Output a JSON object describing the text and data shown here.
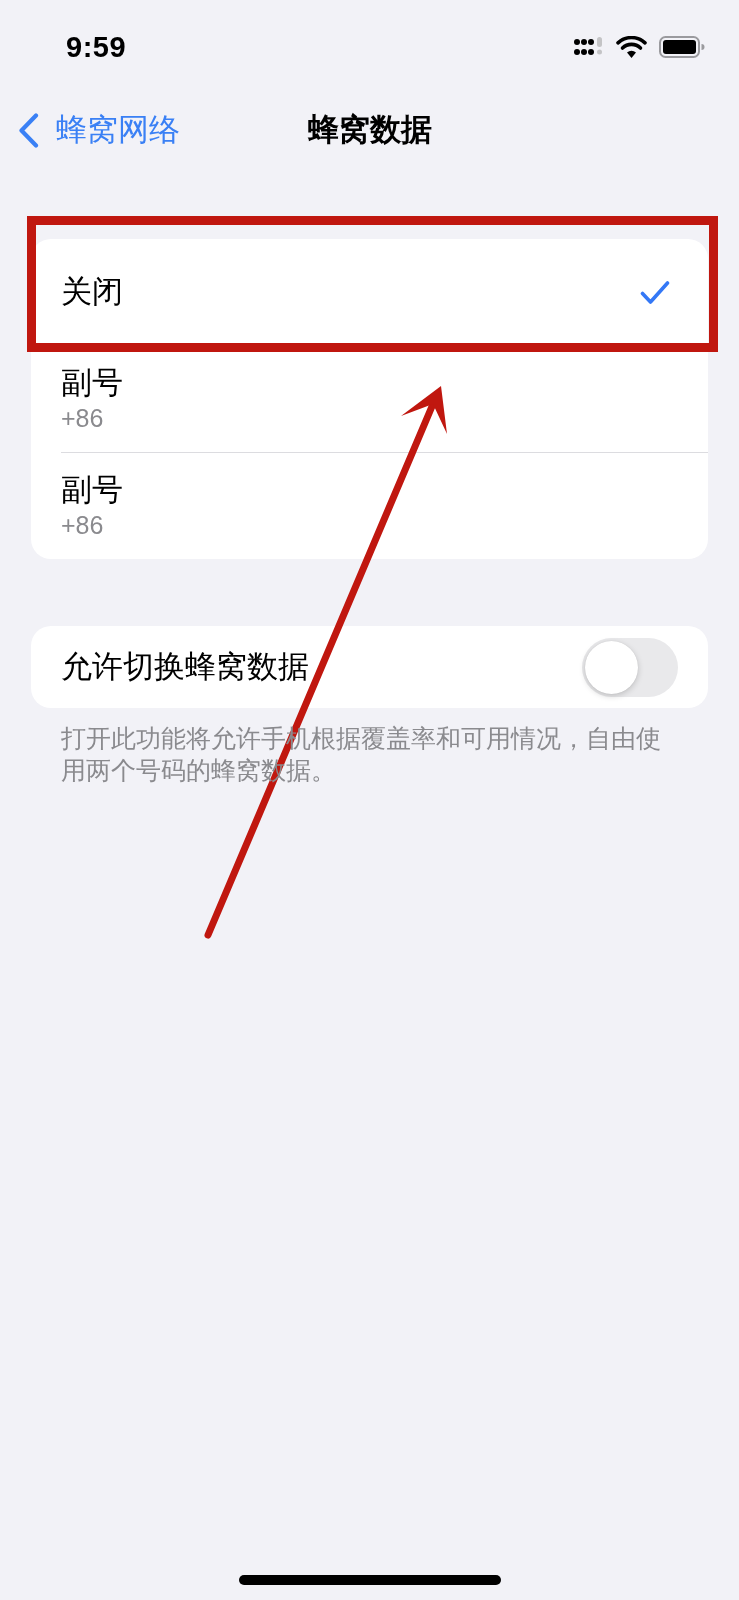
{
  "status_bar": {
    "time": "9:59"
  },
  "nav_bar": {
    "back_label": "蜂窝网络",
    "title": "蜂窝数据"
  },
  "sim_options": [
    {
      "label": "关闭",
      "selected": true,
      "highlighted": true
    },
    {
      "label": "副号",
      "detail": "+86",
      "selected": false,
      "highlighted": false
    },
    {
      "label": "副号",
      "detail": "+86",
      "selected": false,
      "highlighted": false
    }
  ],
  "switch_row": {
    "label": "允许切换蜂窝数据",
    "on": false
  },
  "footer_note": "打开此功能将允许手机根据覆盖率和可用情况，自由使用两个号码的蜂窝数据。",
  "annotations": [
    {
      "kind": "arrow"
    }
  ]
}
